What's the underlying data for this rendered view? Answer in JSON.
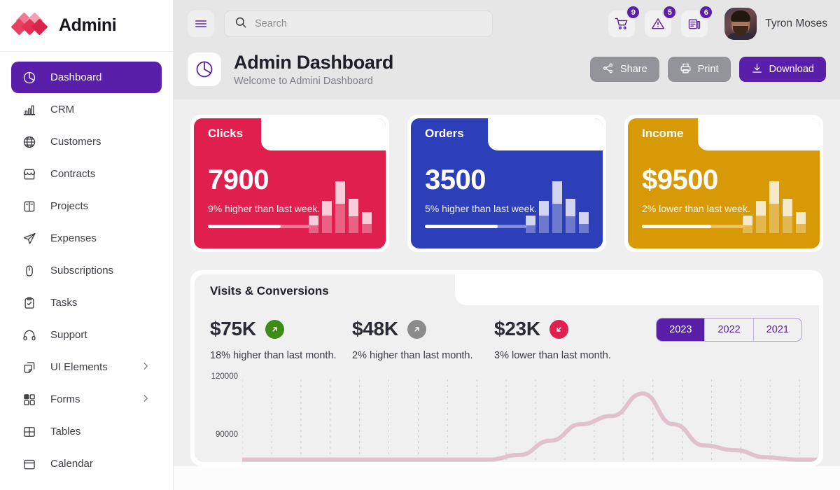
{
  "brand": {
    "name": "Admini"
  },
  "sidebar": {
    "items": [
      {
        "label": "Dashboard",
        "icon": "pie-chart-icon",
        "active": true,
        "caret": false
      },
      {
        "label": "CRM",
        "icon": "bar-chart-icon",
        "active": false,
        "caret": false
      },
      {
        "label": "Customers",
        "icon": "globe-icon",
        "active": false,
        "caret": false
      },
      {
        "label": "Contracts",
        "icon": "store-icon",
        "active": false,
        "caret": false
      },
      {
        "label": "Projects",
        "icon": "layout-icon",
        "active": false,
        "caret": false
      },
      {
        "label": "Expenses",
        "icon": "send-icon",
        "active": false,
        "caret": false
      },
      {
        "label": "Subscriptions",
        "icon": "mouse-icon",
        "active": false,
        "caret": false
      },
      {
        "label": "Tasks",
        "icon": "clipboard-check-icon",
        "active": false,
        "caret": false
      },
      {
        "label": "Support",
        "icon": "headphones-icon",
        "active": false,
        "caret": false
      },
      {
        "label": "UI Elements",
        "icon": "copy-icon",
        "active": false,
        "caret": true
      },
      {
        "label": "Forms",
        "icon": "checkbox-grid-icon",
        "active": false,
        "caret": true
      },
      {
        "label": "Tables",
        "icon": "table-icon",
        "active": false,
        "caret": false
      },
      {
        "label": "Calendar",
        "icon": "calendar-icon",
        "active": false,
        "caret": false
      }
    ]
  },
  "topbar": {
    "menu_icon": "hamburger-icon",
    "search": {
      "placeholder": "Search",
      "value": "",
      "icon": "search-icon"
    },
    "notifications": [
      {
        "icon": "cart-icon",
        "count": "9"
      },
      {
        "icon": "warning-icon",
        "count": "5"
      },
      {
        "icon": "news-icon",
        "count": "6"
      }
    ],
    "user": {
      "name": "Tyron Moses",
      "avatar": "user-avatar"
    }
  },
  "page_header": {
    "icon": "pie-chart-icon",
    "title": "Admin Dashboard",
    "subtitle": "Welcome to Admini Dashboard",
    "actions": [
      {
        "label": "Share",
        "icon": "share-icon",
        "style": "grey"
      },
      {
        "label": "Print",
        "icon": "printer-icon",
        "style": "grey"
      },
      {
        "label": "Download",
        "icon": "download-icon",
        "style": "purple"
      }
    ]
  },
  "stat_cards": [
    {
      "title": "Clicks",
      "value": "7900",
      "note": "9% higher than last week.",
      "color": "#e01f4e",
      "progress": 72,
      "bars": [
        34,
        62,
        100,
        66,
        40
      ],
      "bar_split": [
        0.45,
        0.55,
        0.57,
        0.5,
        0.45
      ]
    },
    {
      "title": "Orders",
      "value": "3500",
      "note": "5% higher than last week.",
      "color": "#2d3fb8",
      "progress": 72,
      "bars": [
        34,
        62,
        100,
        66,
        40
      ],
      "bar_split": [
        0.45,
        0.55,
        0.57,
        0.5,
        0.45
      ]
    },
    {
      "title": "Income",
      "value": "$9500",
      "note": "2% lower than last week.",
      "color": "#d79a06",
      "progress": 68,
      "bars": [
        34,
        62,
        100,
        66,
        40
      ],
      "bar_split": [
        0.45,
        0.55,
        0.57,
        0.5,
        0.45
      ]
    }
  ],
  "visits_panel": {
    "title": "Visits & Conversions",
    "kpis": [
      {
        "value": "$75K",
        "note": "18% higher than last month.",
        "direction": "up",
        "color": "#3d8c16"
      },
      {
        "value": "$48K",
        "note": "2% higher than last month.",
        "direction": "up",
        "color": "#8b8b8b"
      },
      {
        "value": "$23K",
        "note": "3% lower than last month.",
        "direction": "down",
        "color": "#e01f4e"
      }
    ],
    "years": [
      {
        "label": "2023",
        "selected": true
      },
      {
        "label": "2022",
        "selected": false
      },
      {
        "label": "2021",
        "selected": false
      }
    ]
  },
  "chart_data": {
    "type": "line",
    "title": "Visits & Conversions",
    "xlabel": "",
    "ylabel": "",
    "ylim": [
      60000,
      130000
    ],
    "yticks": [
      120000,
      90000
    ],
    "ytick_labels": [
      "120000",
      "90000"
    ],
    "grid": "dashed-vertical",
    "series": [
      {
        "name": "Visits",
        "color": "#e0c2ce",
        "x": [
          0,
          1,
          2,
          3,
          4,
          5,
          6,
          7,
          8,
          9,
          10,
          11,
          12,
          13,
          14,
          15,
          16,
          17,
          18,
          19,
          20
        ],
        "values": [
          62000,
          62000,
          62000,
          62000,
          62000,
          62000,
          62000,
          62000,
          62000,
          66000,
          78000,
          92000,
          99000,
          118000,
          92000,
          74000,
          70000,
          64000,
          62000,
          62000,
          62000
        ]
      }
    ]
  }
}
